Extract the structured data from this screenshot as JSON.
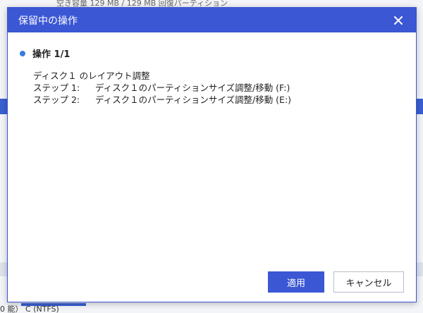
{
  "background": {
    "top_text": "空き容量   129 MB / 129 MB         回復パーティション",
    "bottom_text": "0 能）     C (NTFS)"
  },
  "dialog": {
    "title": "保留中の操作",
    "operation_header": "操作 1/1",
    "description": "ディスク１ のレイアウト調整",
    "steps": [
      {
        "label": "ステップ 1:",
        "text": "ディスク１のパーティションサイズ調整/移動 (F:)"
      },
      {
        "label": "ステップ 2:",
        "text": "ディスク１のパーティションサイズ調整/移動 (E:)"
      }
    ],
    "apply_label": "適用",
    "cancel_label": "キャンセル"
  },
  "colors": {
    "accent": "#3b57d4",
    "bullet": "#3b7be6"
  },
  "icons": {
    "close": "close-icon"
  }
}
